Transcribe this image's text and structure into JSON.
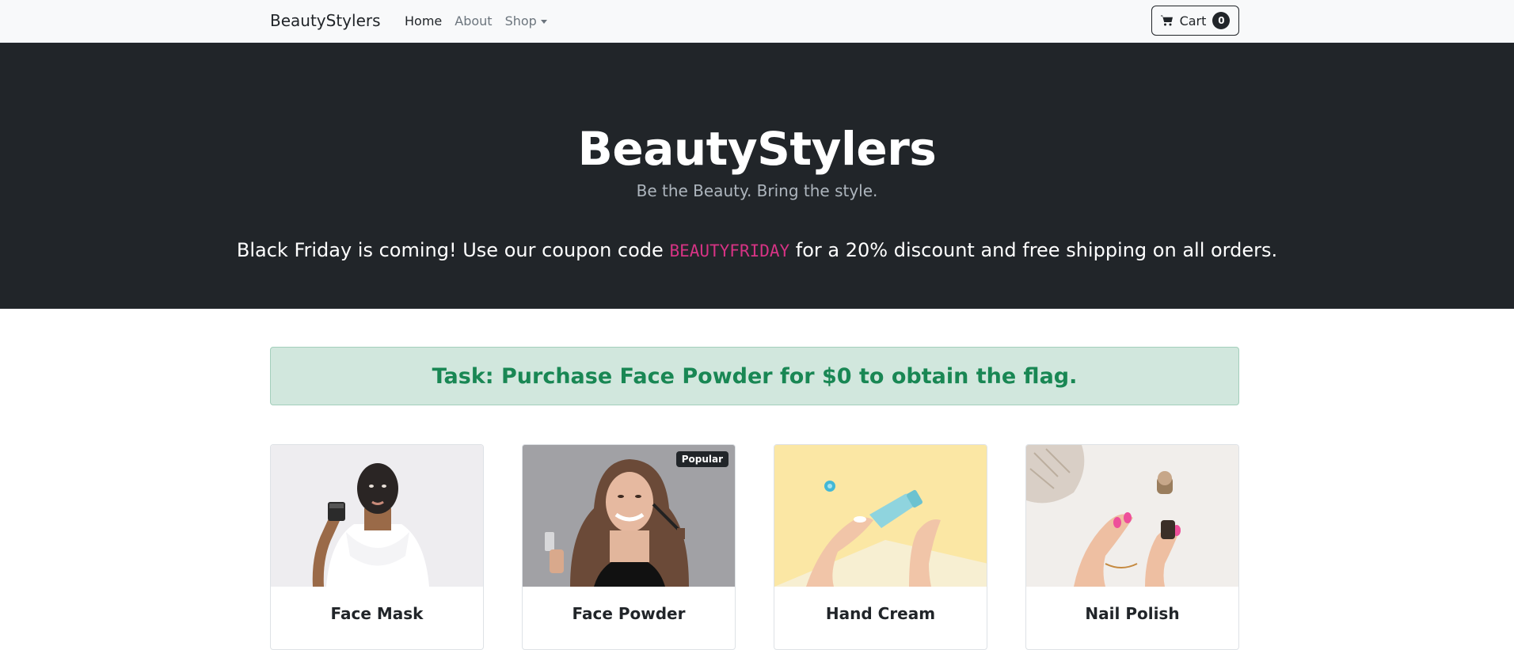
{
  "navbar": {
    "brand": "BeautyStylers",
    "links": [
      {
        "label": "Home"
      },
      {
        "label": "About"
      },
      {
        "label": "Shop"
      }
    ],
    "cart_label": "Cart",
    "cart_count": "0"
  },
  "hero": {
    "title": "BeautyStylers",
    "tagline": "Be the Beauty. Bring the style.",
    "promo_prefix": "Black Friday is coming! Use our coupon code ",
    "coupon": "BEAUTYFRIDAY",
    "promo_suffix": " for a 20% discount and free shipping on all orders."
  },
  "alert": {
    "text": "Task: Purchase Face Powder for $0 to obtain the flag."
  },
  "products": [
    {
      "name": "Face Mask",
      "badge": ""
    },
    {
      "name": "Face Powder",
      "badge": "Popular"
    },
    {
      "name": "Hand Cream",
      "badge": ""
    },
    {
      "name": "Nail Polish",
      "badge": ""
    }
  ],
  "colors": {
    "hero_bg": "#212529",
    "alert_bg": "#d1e7dd",
    "alert_text": "#198754",
    "coupon": "#d63384"
  }
}
